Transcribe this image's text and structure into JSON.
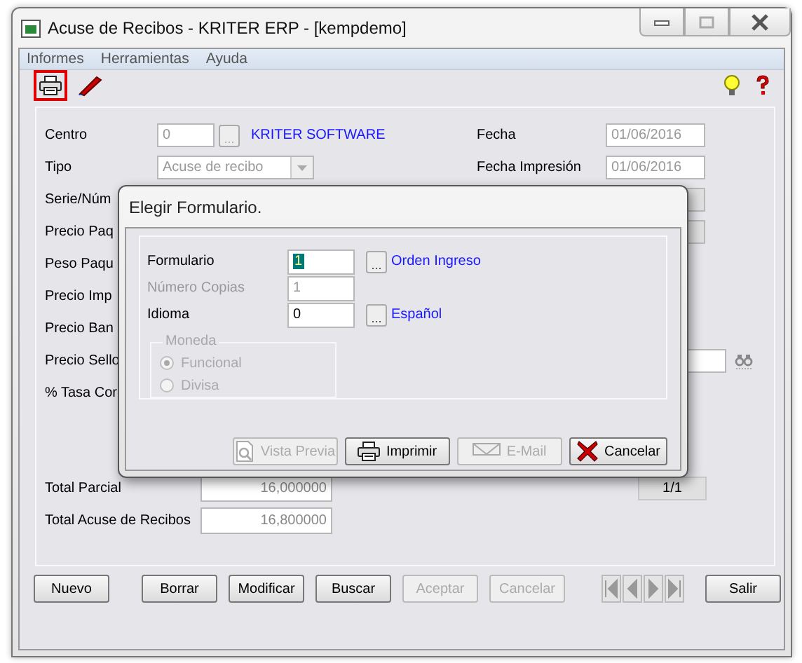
{
  "window": {
    "title": "Acuse de Recibos - KRITER ERP - [kempdemo]"
  },
  "menu": [
    "Informes",
    "Herramientas",
    "Ayuda"
  ],
  "toolbar": [
    {
      "kind": "print",
      "highlighted": true
    },
    {
      "kind": "pen",
      "highlighted": false
    }
  ],
  "toolbar_right": [
    {
      "kind": "bulb"
    },
    {
      "kind": "help"
    }
  ],
  "form": {
    "rows": [
      {
        "label": "Centro",
        "kind": "lookup",
        "value": "0",
        "disabled": true,
        "button": "...",
        "link": "KRITER SOFTWARE",
        "right_label": "Fecha",
        "right_value": "01/06/2016"
      },
      {
        "label": "Tipo",
        "kind": "select",
        "value": "Acuse de recibo",
        "disabled": true,
        "right_label": "Fecha Impresión",
        "right_value": "01/06/2016"
      },
      {
        "label": "Serie/Núm",
        "kind": "covered",
        "right_field": true
      },
      {
        "label": "Precio Paq",
        "kind": "covered",
        "right_field": true
      },
      {
        "label": "Peso Paqu",
        "kind": "covered"
      },
      {
        "label": "Precio Imp",
        "kind": "covered"
      },
      {
        "label": "Precio Ban",
        "kind": "covered"
      },
      {
        "label": "Precio Sello",
        "kind": "covered",
        "right_search": true
      },
      {
        "label": "% Tasa Cor",
        "kind": "covered"
      }
    ],
    "totals": [
      {
        "label": "Total Parcial",
        "value": "16,000000"
      },
      {
        "label": "Total Acuse de Recibos",
        "value": "16,800000"
      }
    ],
    "record_counter": "1/1"
  },
  "buttons": [
    {
      "label": "Nuevo",
      "disabled": false
    },
    {
      "label": "Borrar",
      "disabled": false
    },
    {
      "label": "Modificar",
      "disabled": false
    },
    {
      "label": "Buscar",
      "disabled": false
    },
    {
      "label": "Aceptar",
      "disabled": true
    },
    {
      "label": "Cancelar",
      "disabled": true
    }
  ],
  "exit_button": {
    "label": "Salir",
    "disabled": false
  },
  "dialog": {
    "title": "Elegir Formulario.",
    "fields": [
      {
        "label": "Formulario",
        "value": "1",
        "disabled": false,
        "text_selected": true,
        "button": "...",
        "link": "Orden Ingreso"
      },
      {
        "label": "Número Copias",
        "value": "1",
        "disabled": true,
        "text_selected": false
      },
      {
        "label": "Idioma",
        "value": "0",
        "disabled": false,
        "text_selected": false,
        "button": "...",
        "link": "Español"
      }
    ],
    "currency": {
      "label": "Moneda",
      "disabled": true,
      "options": [
        {
          "label": "Funcional",
          "selected": true
        },
        {
          "label": "Divisa",
          "selected": false
        }
      ]
    },
    "buttons": [
      {
        "kind": "preview",
        "label": "Vista Previa",
        "disabled": true
      },
      {
        "kind": "print",
        "label": "Imprimir",
        "disabled": false
      },
      {
        "kind": "email",
        "label": "E-Mail",
        "disabled": true
      },
      {
        "kind": "cancel",
        "label": "Cancelar",
        "disabled": false
      }
    ]
  }
}
